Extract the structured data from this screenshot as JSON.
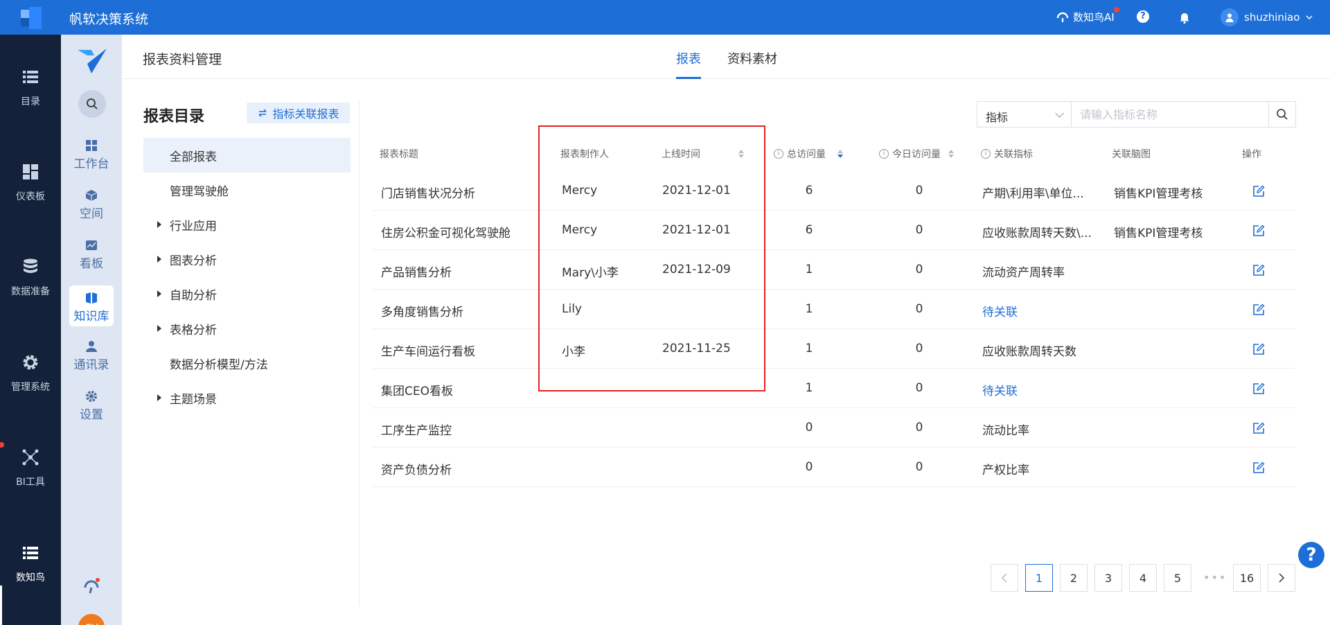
{
  "topbar": {
    "app_title": "帆软决策系统",
    "ai_label": "数知鸟AI",
    "help_glyph": "?",
    "user_name": "shuzhiniao",
    "brand_color": "#1d6ed6"
  },
  "rail": {
    "items": [
      {
        "label": "目录",
        "icon": "list-icon"
      },
      {
        "label": "仪表板",
        "icon": "dashboard-icon"
      },
      {
        "label": "数据准备",
        "icon": "database-icon"
      },
      {
        "label": "管理系统",
        "icon": "gear-icon"
      },
      {
        "label": "BI工具",
        "icon": "network-icon"
      },
      {
        "label": "数知鸟",
        "icon": "list-icon"
      }
    ]
  },
  "nav2": {
    "items": [
      {
        "label": "工作台",
        "icon": "grid-icon"
      },
      {
        "label": "空间",
        "icon": "cube-icon"
      },
      {
        "label": "看板",
        "icon": "chart-board-icon"
      },
      {
        "label": "知识库",
        "icon": "book-icon"
      },
      {
        "label": "通讯录",
        "icon": "contacts-icon"
      },
      {
        "label": "设置",
        "icon": "gear-icon"
      }
    ],
    "avatar_initials": "cy"
  },
  "page": {
    "title": "报表资料管理",
    "tabs": [
      {
        "label": "报表"
      },
      {
        "label": "资料素材"
      }
    ]
  },
  "directory": {
    "title": "报表目录",
    "link_label": "指标关联报表",
    "items": [
      {
        "label": "全部报表"
      },
      {
        "label": "管理驾驶舱"
      },
      {
        "label": "行业应用"
      },
      {
        "label": "图表分析"
      },
      {
        "label": "自助分析"
      },
      {
        "label": "表格分析"
      },
      {
        "label": "数据分析模型/方法"
      },
      {
        "label": "主题场景"
      }
    ]
  },
  "search": {
    "select_value": "指标",
    "placeholder": "请输入指标名称"
  },
  "table": {
    "headers": {
      "title": "报表标题",
      "author": "报表制作人",
      "online_time": "上线时间",
      "total_visits": "总访问量",
      "today_visits": "今日访问量",
      "related_metric": "关联指标",
      "related_mindmap": "关联脑图",
      "action": "操作"
    },
    "info_glyph": "i",
    "rows": [
      {
        "title": "门店销售状况分析",
        "author": "Mercy",
        "date": "2021-12-01",
        "total": "6",
        "today": "0",
        "metric": "产期\\利用率\\单位...",
        "mindmap": "销售KPI管理考核"
      },
      {
        "title": "住房公积金可视化驾驶舱",
        "author": "Mercy",
        "date": "2021-12-01",
        "total": "6",
        "today": "0",
        "metric": "应收账款周转天数\\...",
        "mindmap": "销售KPI管理考核"
      },
      {
        "title": "产品销售分析",
        "author": "Mary\\小李",
        "date": "2021-12-09",
        "total": "1",
        "today": "0",
        "metric": "流动资产周转率",
        "mindmap": ""
      },
      {
        "title": "多角度销售分析",
        "author": "Lily",
        "date": "",
        "total": "1",
        "today": "0",
        "metric": "待关联",
        "mindmap": ""
      },
      {
        "title": "生产车间运行看板",
        "author": "小李",
        "date": "2021-11-25",
        "total": "1",
        "today": "0",
        "metric": "应收账款周转天数",
        "mindmap": ""
      },
      {
        "title": "集团CEO看板",
        "author": "",
        "date": "",
        "total": "1",
        "today": "0",
        "metric": "待关联",
        "mindmap": ""
      },
      {
        "title": "工序生产监控",
        "author": "",
        "date": "",
        "total": "0",
        "today": "0",
        "metric": "流动比率",
        "mindmap": ""
      },
      {
        "title": "资产负债分析",
        "author": "",
        "date": "",
        "total": "0",
        "today": "0",
        "metric": "产权比率",
        "mindmap": ""
      }
    ]
  },
  "pagination": {
    "pages": [
      "1",
      "2",
      "3",
      "4",
      "5"
    ],
    "ellipsis": "•••",
    "last": "16",
    "current": "1"
  },
  "help_fab_glyph": "?"
}
